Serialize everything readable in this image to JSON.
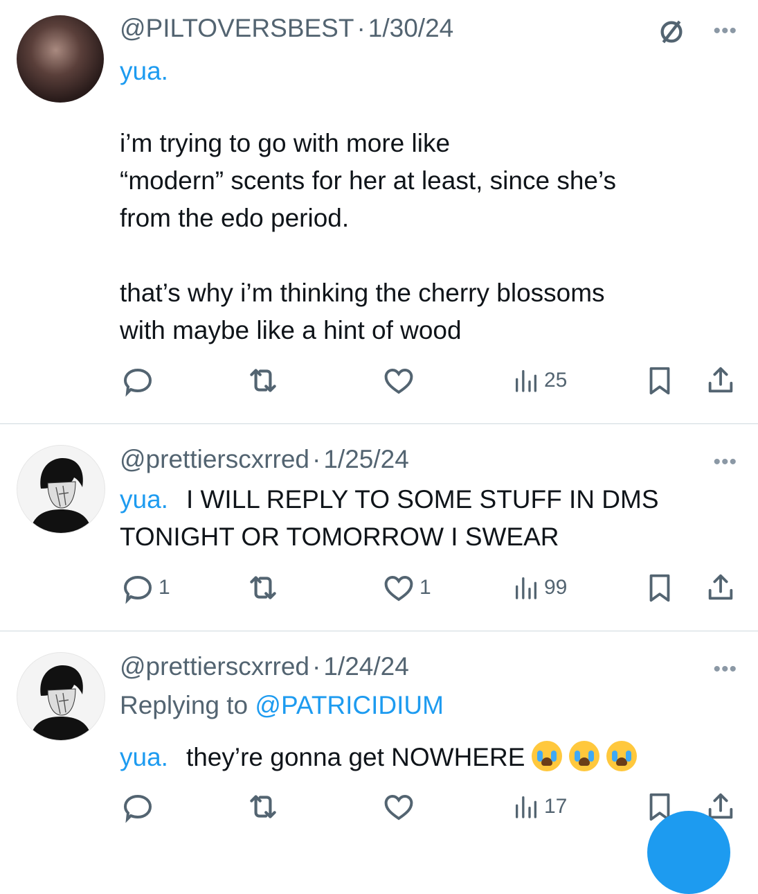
{
  "tweets": [
    {
      "handle": "@PILTOVERSBEST",
      "sep": "·",
      "date": "1/30/24",
      "name_tag": "yua.",
      "paragraphs": [
        [
          "i’m trying to go with more like",
          "“modern” scents for her at least, since she’s",
          "from the edo period."
        ],
        [
          "that’s why i’m thinking the cherry blossoms",
          "with maybe like a hint of wood"
        ]
      ],
      "actions": {
        "replies": "",
        "reposts": "",
        "likes": "",
        "views": "25"
      }
    },
    {
      "handle": "@prettierscxrred",
      "sep": "·",
      "date": "1/25/24",
      "name_tag": "yua.",
      "lines": [
        "I WILL REPLY TO SOME STUFF IN DMS",
        "TONIGHT OR TOMORROW I SWEAR"
      ],
      "actions": {
        "replies": "1",
        "reposts": "",
        "likes": "1",
        "views": "99"
      }
    },
    {
      "handle": "@prettierscxrred",
      "sep": "·",
      "date": "1/24/24",
      "replying_prefix": "Replying to",
      "replying_to": "@PATRICIDIUM",
      "name_tag": "yua.",
      "text": "they’re gonna get NOWHERE",
      "emoji": [
        "loudly-crying-face",
        "loudly-crying-face",
        "loudly-crying-face"
      ],
      "actions": {
        "replies": "",
        "reposts": "",
        "likes": "",
        "views": "17"
      }
    }
  ],
  "more_glyph": "•••",
  "colors": {
    "accent": "#1d9bf0",
    "muted": "#536471",
    "divider": "#cfd9de"
  }
}
